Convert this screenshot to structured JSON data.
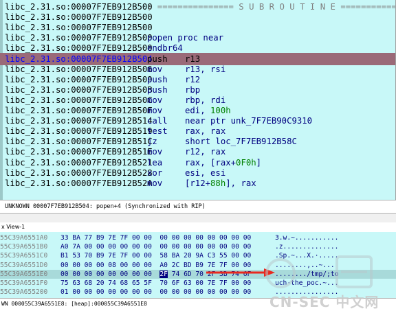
{
  "disasm": {
    "lines": [
      {
        "addr": "libc_2.31.so:00007F7EB912B500",
        "sep": "; =============== S U B R O U T I N E ======================================="
      },
      {
        "addr": "libc_2.31.so:00007F7EB912B500"
      },
      {
        "addr": "libc_2.31.so:00007F7EB912B500"
      },
      {
        "addr": "libc_2.31.so:00007F7EB912B500",
        "mnem": "popen proc near"
      },
      {
        "addr": "libc_2.31.so:00007F7EB912B500",
        "mnem": "endbr64"
      },
      {
        "addr": "libc_2.31.so:00007F7EB912B504",
        "mnem": "push",
        "ops": "r13"
      },
      {
        "addr": "libc_2.31.so:00007F7EB912B506",
        "mnem": "mov",
        "ops": "r13, rsi"
      },
      {
        "addr": "libc_2.31.so:00007F7EB912B509",
        "mnem": "push",
        "ops": "r12"
      },
      {
        "addr": "libc_2.31.so:00007F7EB912B50B",
        "mnem": "push",
        "ops": "rbp"
      },
      {
        "addr": "libc_2.31.so:00007F7EB912B50C",
        "mnem": "mov",
        "ops": "rbp, rdi"
      },
      {
        "addr": "libc_2.31.so:00007F7EB912B50F",
        "mnem": "mov",
        "ops_a": "edi, ",
        "ops_num": "100h"
      },
      {
        "addr": "libc_2.31.so:00007F7EB912B514",
        "mnem": "call",
        "ops": "near ptr unk_7F7EB90C9310"
      },
      {
        "addr": "libc_2.31.so:00007F7EB912B519",
        "mnem": "test",
        "ops": "rax, rax"
      },
      {
        "addr": "libc_2.31.so:00007F7EB912B51C",
        "mnem": "jz",
        "ops": "short loc_7F7EB912B58C"
      },
      {
        "addr": "libc_2.31.so:00007F7EB912B51E",
        "mnem": "mov",
        "ops": "r12, rax"
      },
      {
        "addr": "libc_2.31.so:00007F7EB912B521",
        "mnem": "lea",
        "ops_a": "rax, [rax+",
        "ops_num": "0F0h",
        "ops_b": "]"
      },
      {
        "addr": "libc_2.31.so:00007F7EB912B528",
        "mnem": "xor",
        "ops": "esi, esi"
      },
      {
        "addr": "libc_2.31.so:00007F7EB912B52A",
        "mnem": "mov",
        "ops_a": "[r12+",
        "ops_num": "88h",
        "ops_b": "], rax"
      }
    ],
    "status": "UNKNOWN 00007F7EB912B504: popen+4 (Synchronized with RIP)"
  },
  "hex": {
    "title": "x View-1",
    "rows": [
      {
        "addr": "55C39A6551A0",
        "bytes": "33 BA 77 B9 7E 7F 00 00  00 00 00 00 00 00 00 00",
        "ascii": "3.w.~..........."
      },
      {
        "addr": "55C39A6551B0",
        "bytes": "A0 7A 00 00 00 00 00 00  00 00 00 00 00 00 00 00",
        "ascii": ".z.............."
      },
      {
        "addr": "55C39A6551C0",
        "bytes": "B1 53 70 B9 7E 7F 00 00  58 BA 20 9A C3 55 00 00",
        "ascii": ".Sp.~...X.·....."
      },
      {
        "addr": "55C39A6551D0",
        "bytes": "00 00 00 00 08 00 00 00  A0 2C BD B9 7E 7F 00 00",
        "ascii": "........,..~..."
      },
      {
        "addr": "55C39A6551E0",
        "bytes_pre": "00 00 00 00 00 00 00 00  ",
        "bytes_sel": "2F",
        "bytes_post": " 74 6D 70 2F 3B 74 6F",
        "ascii": "......../tmp/;to"
      },
      {
        "addr": "55C39A6551F0",
        "bytes": "75 63 68 20 74 68 65 5F  70 6F 63 00 7E 7F 00 00",
        "ascii": "uch·the_poc.~..."
      },
      {
        "addr": "55C39A655200",
        "bytes": "01 00 00 00 00 00 00 00  00 00 00 00 00 00 00 00",
        "ascii": "................"
      }
    ],
    "status": "WN 000055C39A6551E8: [heap]:000055C39A6551E8"
  },
  "watermark": "CN-SEC 中文网",
  "colors": {
    "background": "#c8f8f8",
    "highlight": "#9a6a78",
    "arrow": "#e8281e"
  }
}
